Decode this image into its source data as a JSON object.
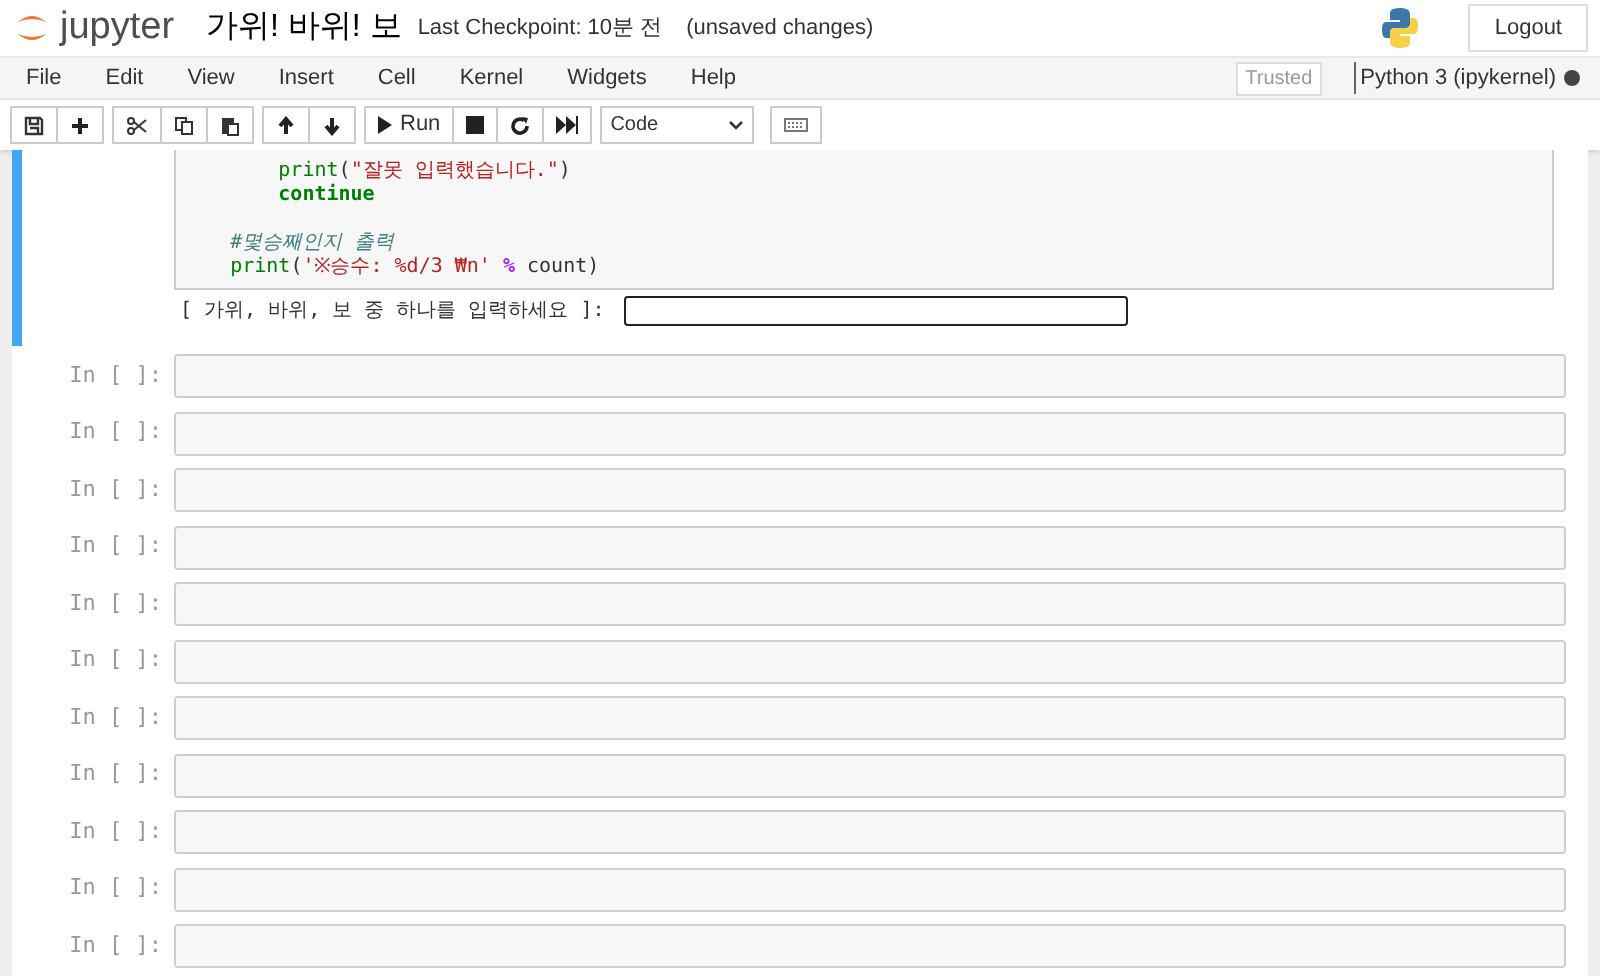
{
  "header": {
    "logo_text": "jupyter",
    "notebook_title": "가위! 바위! 보",
    "checkpoint": "Last Checkpoint: 10분 전",
    "save_status": "(unsaved changes)",
    "logout": "Logout"
  },
  "menu": [
    "File",
    "Edit",
    "View",
    "Insert",
    "Cell",
    "Kernel",
    "Widgets",
    "Help"
  ],
  "toolbar": {
    "run_label": "Run",
    "cell_type": "Code",
    "trusted": "Trusted",
    "kernel": "Python 3 (ipykernel)"
  },
  "active_cell": {
    "blocks": [
      [
        [
          {
            "kind": "builtin",
            "text": "        print"
          },
          {
            "kind": "plain",
            "text": "("
          },
          {
            "kind": "string",
            "text": "\"잘못 입력했습니다.\""
          },
          {
            "kind": "plain",
            "text": ")"
          }
        ],
        [
          {
            "kind": "keyword",
            "text": "        continue"
          }
        ]
      ],
      [
        [
          {
            "kind": "comment",
            "text": "    #몇승째인지 출력"
          }
        ],
        [
          {
            "kind": "builtin",
            "text": "    print"
          },
          {
            "kind": "plain",
            "text": "("
          },
          {
            "kind": "string",
            "text": "'※승수: %d/3 ₩n' "
          },
          {
            "kind": "operator",
            "text": "%"
          },
          {
            "kind": "plain",
            "text": " count)"
          }
        ]
      ]
    ],
    "prompt": "[ 가위, 바위, 보 중 하나를 입력하세요 ]: "
  },
  "empty_cells": [
    "In [ ]:",
    "In [ ]:",
    "In [ ]:",
    "In [ ]:",
    "In [ ]:",
    "In [ ]:",
    "In [ ]:",
    "In [ ]:",
    "In [ ]:",
    "In [ ]:",
    "In [ ]:"
  ]
}
